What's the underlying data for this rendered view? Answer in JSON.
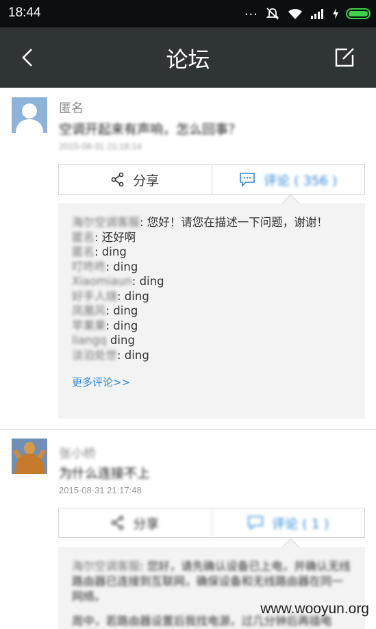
{
  "status_bar": {
    "time": "18:44",
    "more_dots": "...",
    "icons": [
      "mute-icon",
      "wifi-icon",
      "signal-icon",
      "charging-icon",
      "battery-icon"
    ],
    "battery_color": "#3fd14a"
  },
  "nav": {
    "title": "论坛",
    "back_icon": "back-arrow-icon",
    "compose_icon": "compose-icon",
    "background": "#2f3436"
  },
  "posts": [
    {
      "author": "匿名",
      "title": "空调开起来有声响，怎么回事？",
      "time": "2015-08-31 21:18:14",
      "share_label": "分享",
      "comment_label": "评论 ( 356 )",
      "comments": [
        {
          "name": "海尔空调客服",
          "text": ": 您好！请您在描述一下问题，谢谢！"
        },
        {
          "name": "匿名",
          "text": ": 还好啊"
        },
        {
          "name": "匿名",
          "text": ": ding"
        },
        {
          "name": "叮咚咚",
          "text": ": ding"
        },
        {
          "name": "Xiaomiaun",
          "text": ": ding"
        },
        {
          "name": "好手人烧",
          "text": ": ding"
        },
        {
          "name": "凤凰风",
          "text": ": ding"
        },
        {
          "name": "苹果果",
          "text": ": ding"
        },
        {
          "name": "liangq",
          "text": " ding"
        },
        {
          "name": "淡泊处世",
          "text": ": ding"
        }
      ],
      "more_label": "更多评论>>"
    },
    {
      "author": "张小桥",
      "title": "为什么连接不上",
      "time": "2015-08-31 21:17:48",
      "share_label": "分享",
      "comment_label": "评论 ( 1 )",
      "comments": [
        {
          "name": "海尔空调客服",
          "text": ": 您好，请先确认设备已上电，并确认无线路由器已连接到互联网，确保设备和无线路由器在同一网络。"
        },
        {
          "name": "",
          "text": "周中，若路由器设置后我找电源，过几分钟后再插电"
        }
      ]
    }
  ],
  "watermark": "www.wooyun.org",
  "colors": {
    "accent": "#2b88d8",
    "comment_bg": "#f3f3f3"
  }
}
